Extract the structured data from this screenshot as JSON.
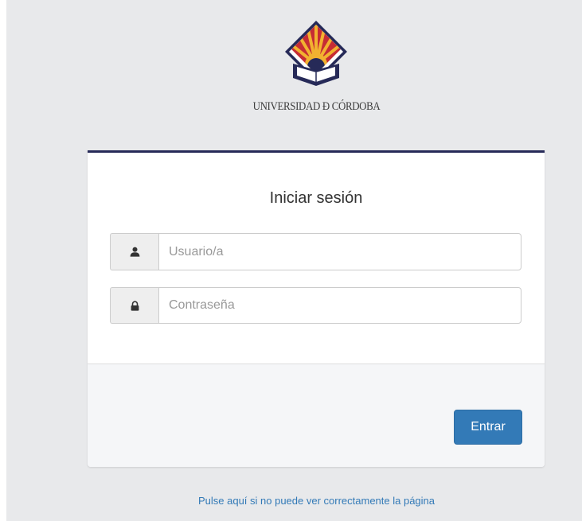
{
  "brand": {
    "name": "UNIVERSIDAD Ð CÓRDOBA",
    "colors": {
      "navy": "#262a58",
      "crimson": "#b8252e",
      "gold": "#e9a61c"
    }
  },
  "login": {
    "title": "Iniciar sesión",
    "username": {
      "placeholder": "Usuario/a",
      "value": "",
      "icon": "user-icon"
    },
    "password": {
      "placeholder": "Contraseña",
      "value": "",
      "icon": "lock-icon"
    },
    "submit_label": "Entrar",
    "accent": "#337ab7",
    "header_bar_color": "#262a58"
  },
  "footer": {
    "help_link": "Pulse aquí si no puede ver correctamente la página"
  }
}
